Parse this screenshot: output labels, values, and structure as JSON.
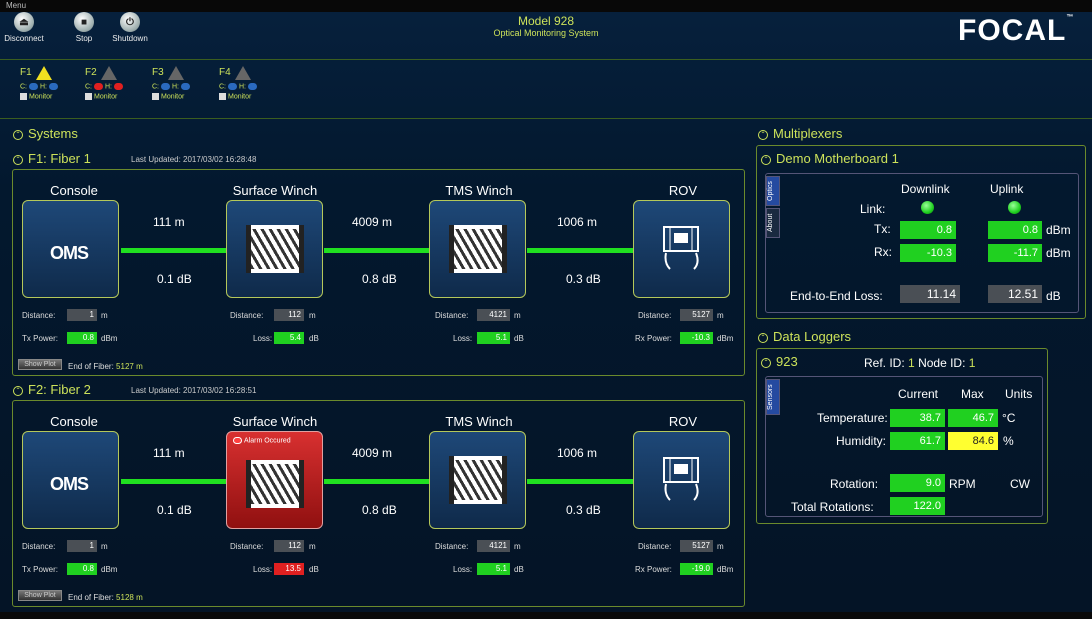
{
  "menu": "Menu",
  "toolbar": {
    "disconnect": "Disconnect",
    "stop": "Stop",
    "shutdown": "Shutdown"
  },
  "header": {
    "title": "Model 928",
    "subtitle": "Optical Monitoring System",
    "logo": "FOCAL",
    "logo_tm": "™"
  },
  "fibers_status": [
    {
      "label": "F1",
      "alarm": true,
      "c": "C:",
      "h": "H:",
      "c_color": "blue",
      "h_color": "blue",
      "monitor": "Monitor"
    },
    {
      "label": "F2",
      "alarm": false,
      "c": "C:",
      "h": "H:",
      "c_color": "red",
      "h_color": "red",
      "monitor": "Monitor"
    },
    {
      "label": "F3",
      "alarm": false,
      "c": "C:",
      "h": "H:",
      "c_color": "blue",
      "h_color": "blue",
      "monitor": "Monitor"
    },
    {
      "label": "F4",
      "alarm": false,
      "c": "C:",
      "h": "H:",
      "c_color": "blue",
      "h_color": "blue",
      "monitor": "Monitor"
    }
  ],
  "systems": {
    "title": "Systems"
  },
  "fiber1": {
    "title": "F1: Fiber 1",
    "updated": "Last Updated: 2017/03/02 16:28:48",
    "nodes": [
      "Console",
      "Surface Winch",
      "TMS Winch",
      "ROV"
    ],
    "links": [
      {
        "dist": "111 m",
        "loss": "0.1 dB"
      },
      {
        "dist": "4009 m",
        "loss": "0.8 dB"
      },
      {
        "dist": "1006 m",
        "loss": "0.3 dB"
      }
    ],
    "distance_label": "Distance:",
    "m": "m",
    "dB": "dB",
    "dBm": "dBm",
    "distances": [
      "1",
      "112",
      "4121",
      "5127"
    ],
    "txpower_label": "Tx Power:",
    "txpower": "0.8",
    "loss_label": "Loss:",
    "loss1": "5.4",
    "loss2": "5.1",
    "rxpower_label": "Rx Power:",
    "rxpower": "-10.3",
    "show_plot": "Show Plot",
    "eof_label": "End of Fiber:",
    "eof": "5127 m"
  },
  "fiber2": {
    "title": "F2: Fiber 2",
    "updated": "Last Updated: 2017/03/02 16:28:51",
    "nodes": [
      "Console",
      "Surface Winch",
      "TMS Winch",
      "ROV"
    ],
    "alarm": "Alarm Occured",
    "links": [
      {
        "dist": "111 m",
        "loss": "0.1 dB"
      },
      {
        "dist": "4009 m",
        "loss": "0.8 dB"
      },
      {
        "dist": "1006 m",
        "loss": "0.3 dB"
      }
    ],
    "distance_label": "Distance:",
    "m": "m",
    "dB": "dB",
    "dBm": "dBm",
    "distances": [
      "1",
      "112",
      "4121",
      "5127"
    ],
    "txpower_label": "Tx Power:",
    "txpower": "0.8",
    "loss_label": "Loss:",
    "loss1": "13.5",
    "loss2": "5.1",
    "rxpower_label": "Rx Power:",
    "rxpower": "-19.0",
    "show_plot": "Show Plot",
    "eof_label": "End of Fiber:",
    "eof": "5128 m"
  },
  "oms": "OMS",
  "multiplexers": {
    "title": "Multiplexers",
    "board": "Demo Motherboard 1",
    "tabs": [
      "Optics",
      "About"
    ],
    "downlink": "Downlink",
    "uplink": "Uplink",
    "link_label": "Link:",
    "tx_label": "Tx:",
    "rx_label": "Rx:",
    "tx_down": "0.8",
    "tx_up": "0.8",
    "rx_down": "-10.3",
    "rx_up": "-11.7",
    "dBm": "dBm",
    "e2e_label": "End-to-End Loss:",
    "e2e_down": "11.14",
    "e2e_up": "12.51",
    "dB": "dB"
  },
  "dataloggers": {
    "title": "Data Loggers",
    "id": "923",
    "refid_label": "Ref. ID:",
    "refid": "1",
    "nodeid_label": "Node ID:",
    "nodeid": "1",
    "tab": "Sensors",
    "current": "Current",
    "max": "Max",
    "units": "Units",
    "temp_label": "Temperature:",
    "temp_cur": "38.7",
    "temp_max": "46.7",
    "temp_unit": "°C",
    "hum_label": "Humidity:",
    "hum_cur": "61.7",
    "hum_max": "84.6",
    "hum_unit": "%",
    "rot_label": "Rotation:",
    "rot": "9.0",
    "rot_unit": "RPM",
    "rot_dir": "CW",
    "totrot_label": "Total Rotations:",
    "totrot": "122.0"
  },
  "colors": {
    "accent": "#cde25a",
    "ok": "#20d020",
    "alarm": "#e02020",
    "warn": "#ffff30"
  }
}
